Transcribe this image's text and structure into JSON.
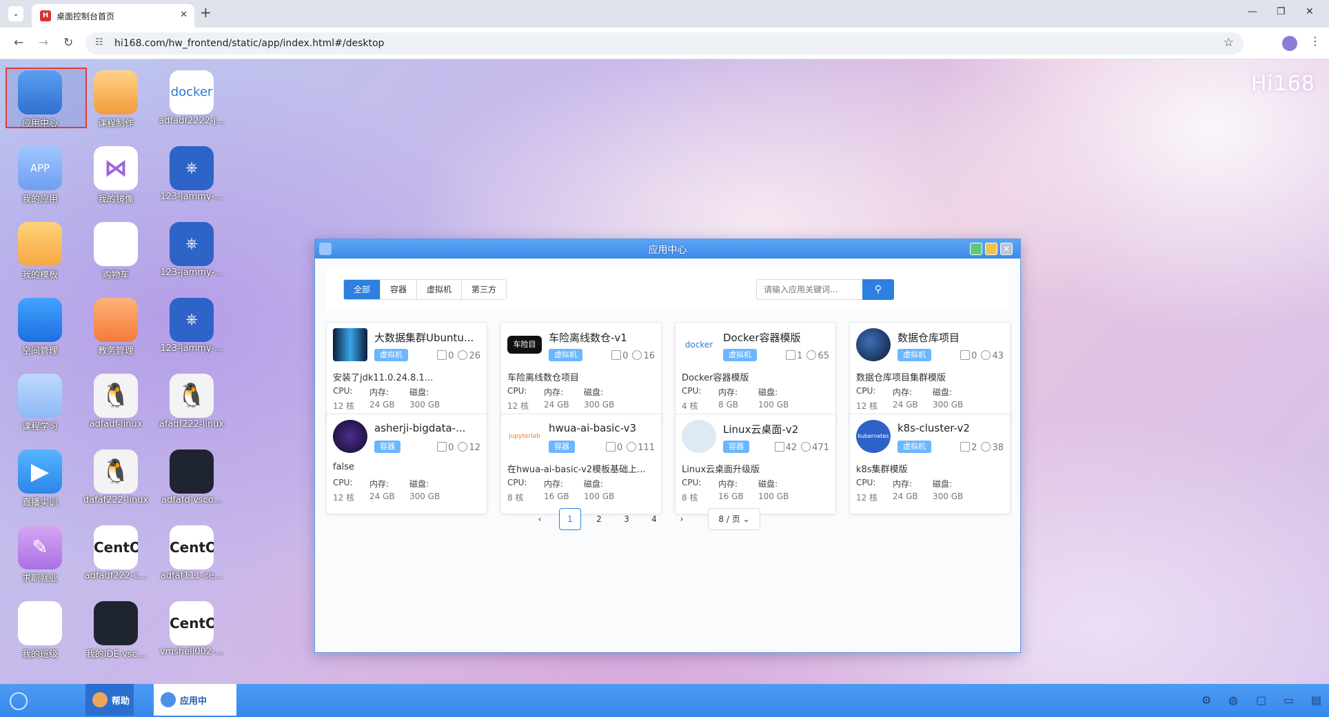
{
  "browser": {
    "tab_title": "桌面控制台首页",
    "favicon_letter": "H",
    "url": "hi168.com/hw_frontend/static/app/index.html#/desktop"
  },
  "brand": "Hi168",
  "desktop_icons": [
    {
      "label": "应用中心",
      "icon": "app-center-icon"
    },
    {
      "label": "课程制作",
      "icon": "course-make-icon"
    },
    {
      "label": "adfadf2222-j...",
      "icon": "docker-icon"
    },
    {
      "label": "我的应用",
      "icon": "my-app-icon",
      "text": "APP"
    },
    {
      "label": "我的镜像",
      "icon": "mirror-icon"
    },
    {
      "label": "123-jammy-...",
      "icon": "kubernetes-icon"
    },
    {
      "label": "我的模板",
      "icon": "folder-icon"
    },
    {
      "label": "购物车",
      "icon": "cart-icon"
    },
    {
      "label": "123-jammy-...",
      "icon": "kubernetes-icon"
    },
    {
      "label": "空间管理",
      "icon": "space-icon"
    },
    {
      "label": "教务管理",
      "icon": "teach-icon"
    },
    {
      "label": "123-jammy-...",
      "icon": "kubernetes-icon"
    },
    {
      "label": "课程学习",
      "icon": "study-icon"
    },
    {
      "label": "adfadf-linux",
      "icon": "linux-icon"
    },
    {
      "label": "afadf222-linux",
      "icon": "linux-icon"
    },
    {
      "label": "直播实训",
      "icon": "live-icon"
    },
    {
      "label": "dafaf222-linux",
      "icon": "linux-icon"
    },
    {
      "label": "adfafd-vsco...",
      "icon": "vscode-icon"
    },
    {
      "label": "求职就业",
      "icon": "job-icon"
    },
    {
      "label": "adfadf222-c...",
      "icon": "centos-icon"
    },
    {
      "label": "adfaf111-ce...",
      "icon": "centos-icon"
    },
    {
      "label": "我的班级",
      "icon": "class-icon"
    },
    {
      "label": "我的IDE-vsc...",
      "icon": "vscode-icon"
    },
    {
      "label": "vmshell002-...",
      "icon": "centos-icon"
    }
  ],
  "window": {
    "title": "应用中心",
    "filters": [
      "全部",
      "容器",
      "虚拟机",
      "第三方"
    ],
    "active_filter": "全部",
    "search_placeholder": "请输入应用关键词...",
    "labels": {
      "cpu": "CPU:",
      "mem": "内存:",
      "disk": "磁盘:"
    },
    "cards": [
      {
        "title": "大数据集群Ubuntu...",
        "tag": "虚拟机",
        "docs": "0",
        "users": "26",
        "desc": "安装了jdk11.0.24.8.1...",
        "cpu": "12 核",
        "mem": "24 GB",
        "disk": "300 GB",
        "logo": "bigdata-logo"
      },
      {
        "title": "车险离线数仓-v1",
        "tag": "虚拟机",
        "docs": "0",
        "users": "16",
        "desc": "车险离线数仓项目",
        "cpu": "12 核",
        "mem": "24 GB",
        "disk": "300 GB",
        "logo": "car-insurance-logo",
        "logo_text": "车险目"
      },
      {
        "title": "Docker容器模版",
        "tag": "虚拟机",
        "docs": "1",
        "users": "65",
        "desc": "Docker容器模版",
        "cpu": "4 核",
        "mem": "8 GB",
        "disk": "100 GB",
        "logo": "docker-logo",
        "logo_text": "docker"
      },
      {
        "title": "数据仓库项目",
        "tag": "虚拟机",
        "docs": "0",
        "users": "43",
        "desc": "数据仓库项目集群模版",
        "cpu": "12 核",
        "mem": "24 GB",
        "disk": "300 GB",
        "logo": "data-warehouse-logo"
      },
      {
        "title": "asherji-bigdata-...",
        "tag": "容器",
        "docs": "0",
        "users": "12",
        "desc": "false",
        "cpu": "12 核",
        "mem": "24 GB",
        "disk": "300 GB",
        "logo": "asherji-logo"
      },
      {
        "title": "hwua-ai-basic-v3",
        "tag": "容器",
        "docs": "0",
        "users": "111",
        "desc": "在hwua-ai-basic-v2模板基础上...",
        "cpu": "8 核",
        "mem": "16 GB",
        "disk": "100 GB",
        "logo": "jupyter-logo",
        "logo_text": "jupyterlab"
      },
      {
        "title": "Linux云桌面-v2",
        "tag": "容器",
        "docs": "42",
        "users": "471",
        "desc": "Linux云桌面升级版",
        "cpu": "8 核",
        "mem": "16 GB",
        "disk": "100 GB",
        "logo": "linux-desktop-logo"
      },
      {
        "title": "k8s-cluster-v2",
        "tag": "虚拟机",
        "docs": "2",
        "users": "38",
        "desc": "k8s集群模版",
        "cpu": "12 核",
        "mem": "24 GB",
        "disk": "300 GB",
        "logo": "k8s-logo",
        "logo_text": "kubernetes"
      }
    ],
    "pagination": {
      "prev": "‹",
      "pages": [
        "1",
        "2",
        "3",
        "4"
      ],
      "current": "1",
      "next": "›",
      "page_size": "8 / 页"
    }
  },
  "taskbar": {
    "items": [
      {
        "label": "帮助",
        "icon": "help-avatar-icon"
      },
      {
        "label": "应用中",
        "icon": "app-center-icon"
      }
    ]
  },
  "colors": {
    "accent": "#2d7fe0",
    "tag": "#6ab6ff",
    "taskbar": "#3d8eee"
  }
}
